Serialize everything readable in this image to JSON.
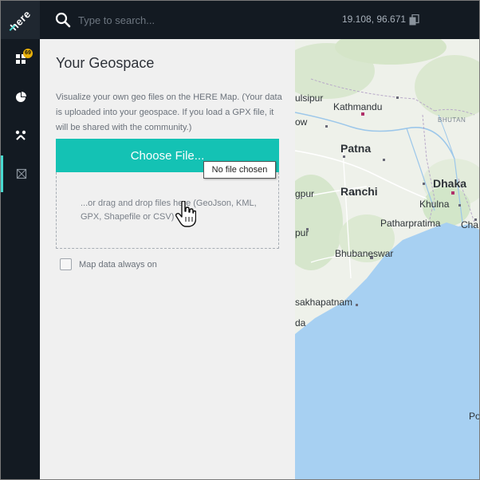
{
  "app": {
    "logo_text": "here",
    "accent": "#14c2b4",
    "rail_bg": "#131a22"
  },
  "sidebar": {
    "items": [
      {
        "icon": "dashboard-icon",
        "badge": "69"
      },
      {
        "icon": "pie-chart-icon"
      },
      {
        "icon": "tools-icon"
      },
      {
        "icon": "layers-icon",
        "active": true
      }
    ]
  },
  "topbar": {
    "search_placeholder": "Type to search...",
    "coordinates": "19.108, 96.671",
    "copy_icon": "clipboard-icon"
  },
  "panel": {
    "title": "Your Geospace",
    "description": "Visualize your own geo files on the HERE Map. (Your data is uploaded into your geospace. If you load a GPX file, it will be shared with the community.)",
    "choose_file_label": "Choose File...",
    "tooltip": "No file chosen",
    "drop_text": "...or drag and drop files here (GeoJson, KML, GPX, Shapefile or CSV)",
    "checkbox_label": "Map data always on"
  },
  "map": {
    "labels": {
      "ulsipur": "ulsipur",
      "kathmandu": "Kathmandu",
      "ow": "ow",
      "bhutan": "BHUTAN",
      "patna": "Patna",
      "ranchi": "Ranchi",
      "dhaka": "Dhaka",
      "gpur": "gpur",
      "khulna": "Khulna",
      "patharpratima": "Patharpratima",
      "cha": "Cha",
      "pur": "pur",
      "bhubaneswar": "Bhubaneswar",
      "sakhapatnam": "sakhapatnam",
      "da": "da",
      "po": "Po"
    },
    "water_color": "#a7d0f2",
    "land_color": "#eef1ea"
  }
}
